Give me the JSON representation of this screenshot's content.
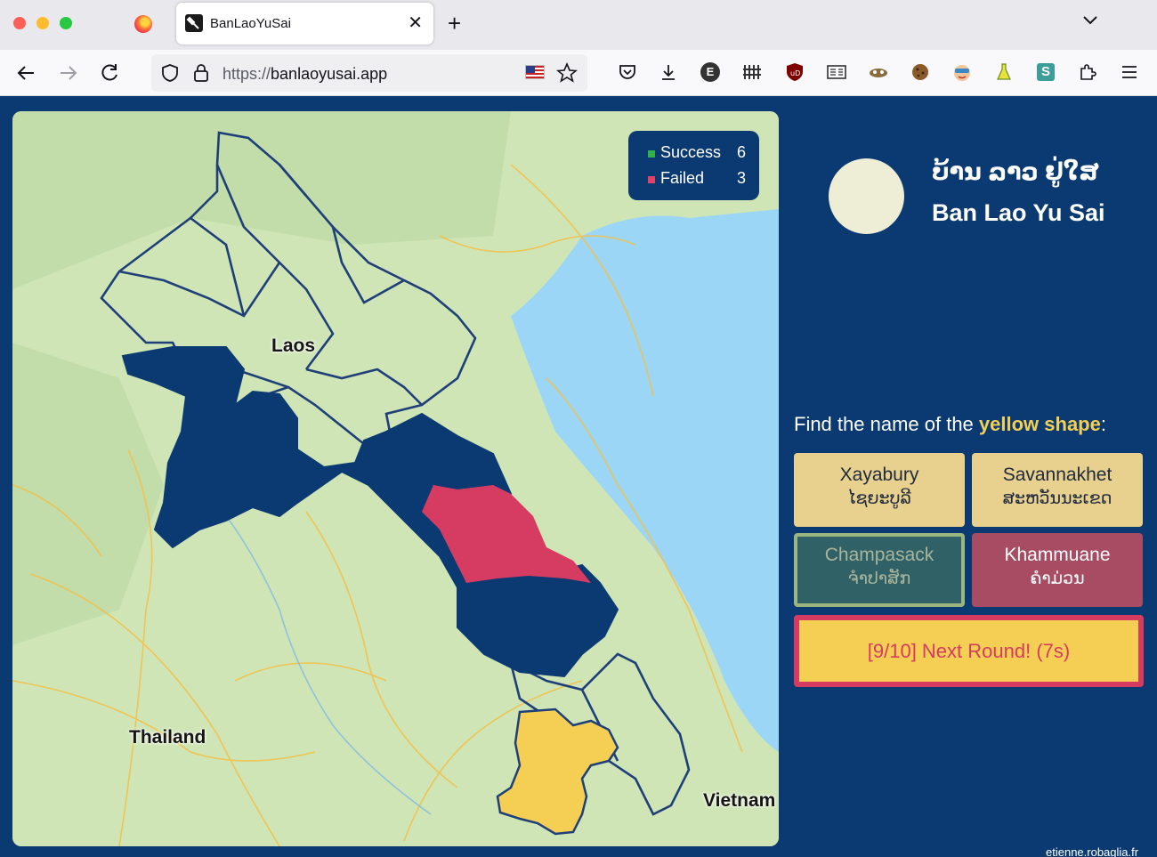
{
  "browser": {
    "tab_title": "BanLaoYuSai",
    "url_protocol": "https://",
    "url_host": "banlaoyusai.app"
  },
  "map": {
    "labels": {
      "laos": "Laos",
      "thailand": "Thailand",
      "vietnam": "Vietnam"
    },
    "colors": {
      "found": "#0b3a73",
      "failed": "#d63c62",
      "target": "#f5cf54",
      "sea": "#9bd6f7",
      "land": "#cfe5b6"
    }
  },
  "score": {
    "success_label": "Success",
    "success_value": "6",
    "failed_label": "Failed",
    "failed_value": "3",
    "success_color": "#2eb34a",
    "failed_color": "#e0436a"
  },
  "header": {
    "title_lao": "ບ້ານ ລາວ ຢູ່ໃສ",
    "title_en": "Ban Lao Yu Sai"
  },
  "question": {
    "prefix": "Find the name of the ",
    "highlight": "yellow shape",
    "suffix": ":"
  },
  "choices": [
    {
      "en": "Xayabury",
      "lo": "ໄຊຍະບູລີ",
      "state": "neutral"
    },
    {
      "en": "Savannakhet",
      "lo": "ສະຫວັນນະເຂດ",
      "state": "neutral"
    },
    {
      "en": "Champasack",
      "lo": "ຈຳປາສັກ",
      "state": "correct"
    },
    {
      "en": "Khammuane",
      "lo": "ຄຳມ່ວນ",
      "state": "wrong"
    }
  ],
  "next_button": "[9/10] Next Round! (7s)",
  "credit": "etienne.robaglia.fr"
}
